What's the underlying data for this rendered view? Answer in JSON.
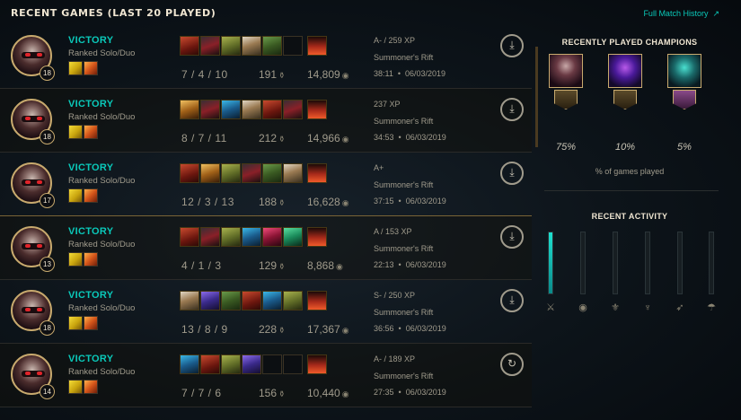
{
  "header": {
    "title": "RECENT GAMES (LAST 20 PLAYED)",
    "history_link": "Full Match History",
    "history_arrow": "↗"
  },
  "games": [
    {
      "result": "VICTORY",
      "queue": "Ranked Solo/Duo",
      "level": "18",
      "kda": "7 / 4 / 10",
      "cs": "191",
      "gold": "14,809",
      "grade": "A- / 259 XP",
      "map": "Summoner's Rift",
      "duration": "38:11",
      "date": "06/03/2019",
      "items": [
        "it-red",
        "it-blade",
        "it-green",
        "it-wing",
        "it-poly",
        "empty"
      ]
    },
    {
      "result": "VICTORY",
      "queue": "Ranked Solo/Duo",
      "level": "18",
      "kda": "8 / 7 / 11",
      "cs": "212",
      "gold": "14,966",
      "grade": "237 XP",
      "map": "Summoner's Rift",
      "duration": "34:53",
      "date": "06/03/2019",
      "items": [
        "it-gold",
        "it-blade",
        "it-blue",
        "it-wing",
        "it-red",
        "it-blade"
      ]
    },
    {
      "result": "VICTORY",
      "queue": "Ranked Solo/Duo",
      "level": "17",
      "kda": "12 / 3 / 13",
      "cs": "188",
      "gold": "16,628",
      "grade": "A+",
      "map": "Summoner's Rift",
      "duration": "37:15",
      "date": "06/03/2019",
      "items": [
        "it-red",
        "it-gold",
        "it-green",
        "it-blade",
        "it-poly",
        "it-wing"
      ]
    },
    {
      "result": "VICTORY",
      "queue": "Ranked Solo/Duo",
      "level": "13",
      "kda": "4 / 1 / 3",
      "cs": "129",
      "gold": "8,868",
      "grade": "A / 153 XP",
      "map": "Summoner's Rift",
      "duration": "22:13",
      "date": "06/03/2019",
      "items": [
        "it-red",
        "it-blade",
        "it-green",
        "it-blue",
        "it-pink",
        "it-teal"
      ]
    },
    {
      "result": "VICTORY",
      "queue": "Ranked Solo/Duo",
      "level": "18",
      "kda": "13 / 8 / 9",
      "cs": "228",
      "gold": "17,367",
      "grade": "S- / 250 XP",
      "map": "Summoner's Rift",
      "duration": "36:56",
      "date": "06/03/2019",
      "items": [
        "it-wing",
        "it-purple",
        "it-poly",
        "it-red",
        "it-blue",
        "it-green"
      ]
    },
    {
      "result": "VICTORY",
      "queue": "Ranked Solo/Duo",
      "level": "14",
      "kda": "7 / 7 / 6",
      "cs": "156",
      "gold": "10,440",
      "grade": "A- / 189 XP",
      "map": "Summoner's Rift",
      "duration": "27:35",
      "date": "06/03/2019",
      "items": [
        "it-blue",
        "it-red",
        "it-green",
        "it-purple",
        "empty",
        "empty"
      ]
    }
  ],
  "sidebar": {
    "recent_champions_title": "RECENTLY PLAYED CHAMPIONS",
    "champions": [
      {
        "pct": "75%",
        "portrait": "cp-kayn",
        "mastery": "m6"
      },
      {
        "pct": "10%",
        "portrait": "cp-kassadin",
        "mastery": "m6"
      },
      {
        "pct": "5%",
        "portrait": "cp-hecarim",
        "mastery": "m7"
      }
    ],
    "pct_caption": "% of games played",
    "recent_activity_title": "RECENT ACTIVITY",
    "activity": [
      {
        "role": "jungle-icon",
        "glyph": "⚔",
        "fraction": 1.0
      },
      {
        "role": "mid-icon",
        "glyph": "◉",
        "fraction": 0
      },
      {
        "role": "top-icon",
        "glyph": "⚜",
        "fraction": 0
      },
      {
        "role": "fighter-icon",
        "glyph": "♆",
        "fraction": 0
      },
      {
        "role": "marksman-icon",
        "glyph": "➶",
        "fraction": 0
      },
      {
        "role": "support-icon",
        "glyph": "☂",
        "fraction": 0
      }
    ]
  },
  "icons": {
    "download": "⤓",
    "replay": "↻",
    "cs": "⚱",
    "gold": "◉"
  },
  "colors": {
    "accent": "#0ac8b9",
    "gold": "#c8aa6e",
    "text": "#a09b8c",
    "title": "#f0e6d2"
  }
}
